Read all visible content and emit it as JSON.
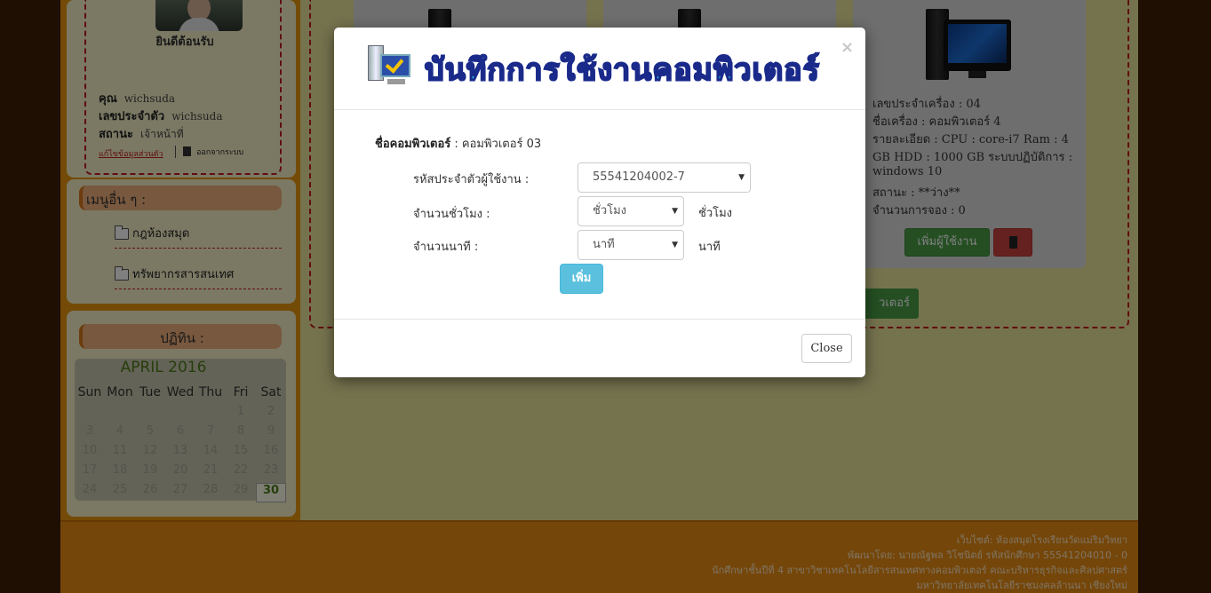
{
  "sidebar": {
    "welcome": "ยินดีต้อนรับ",
    "user_rows": [
      {
        "label": "คุณ",
        "value": "wichsuda"
      },
      {
        "label": "เลขประจำตัว",
        "value": "wichsuda"
      },
      {
        "label": "สถานะ",
        "value": "เจ้าหน้าที่"
      }
    ],
    "edit_profile": "แก้ไขข้อมูลส่วนตัว",
    "logout": "ออกจากระบบ",
    "other_menu_title": "เมนูอื่น ๆ :",
    "menu_items": [
      "กฎห้องสมุด",
      "ทรัพยากรสารสนเทศ"
    ],
    "calendar_title": "ปฏิทิน :",
    "calendar": {
      "month": "APRIL 2016",
      "weekdays": [
        "Sun",
        "Mon",
        "Tue",
        "Wed",
        "Thu",
        "Fri",
        "Sat"
      ],
      "weeks": [
        [
          "",
          "",
          "",
          "",
          "",
          "1",
          "2"
        ],
        [
          "3",
          "4",
          "5",
          "6",
          "7",
          "8",
          "9"
        ],
        [
          "10",
          "11",
          "12",
          "13",
          "14",
          "15",
          "16"
        ],
        [
          "17",
          "18",
          "19",
          "20",
          "21",
          "22",
          "23"
        ],
        [
          "24",
          "25",
          "26",
          "27",
          "28",
          "29",
          "30"
        ]
      ],
      "today": "30"
    }
  },
  "card": {
    "lines": [
      "เลขประจำเครื่อง : 04",
      "ชื่อเครื่อง : คอมพิวเตอร์ 4",
      "รายละเอียด : CPU : core-i7 Ram : 4",
      "GB HDD : 1000 GB ระบบปฏิบัติการ :",
      "windows 10",
      "สถานะ : **ว่าง**",
      "จำนวนการจอง : 0"
    ],
    "add_user_button": "เพิ่มผู้ใช้งาน"
  },
  "main": {
    "bottom_button_partial": "วเตอร์"
  },
  "modal": {
    "title": "บันทึกการใช้งานคอมพิวเตอร์",
    "close_x": "×",
    "computer_name_label": "ชื่อคอมพิวเตอร์",
    "computer_name_value": ": คอมพิวเตอร์ 03",
    "user_id_label": "รหัสประจำตัวผู้ใช้งาน :",
    "user_id_value": "55541204002-7",
    "hours_label": "จำนวนชั่วโมง :",
    "hours_value": "ชั่วโมง",
    "hours_unit": "ชั่วโมง",
    "minutes_label": "จำนวนนาที :",
    "minutes_value": "นาที",
    "minutes_unit": "นาที",
    "add_button": "เพิ่ม",
    "close_button": "Close"
  },
  "footer": {
    "lines": [
      "เว็บไซต์: ห้องสมุดโรงเรียนวัดแม่ริมวิทยา",
      "พัฒนาโดย: นายณัฐพล วิโชนิตย์ รหัสนักศึกษา 55541204010 - 0",
      "นักศึกษาชั้นปีที่ 4 สาขาวิชาเทคโนโลยีสารสนเทศทางคอมพิวเตอร์ คณะบริหารธุรกิจและศิลปศาสตร์",
      "มหาวิทยาลัยเทคโนโลยีราชมงคลล้านนา เชียงใหม่"
    ]
  },
  "colors": {
    "accent": "#2ad3f5",
    "add_button": "#5bc0de",
    "success": "#4a9e47",
    "danger": "#c9433f",
    "footer": "#ea8d12",
    "background": "#e8e49a"
  }
}
